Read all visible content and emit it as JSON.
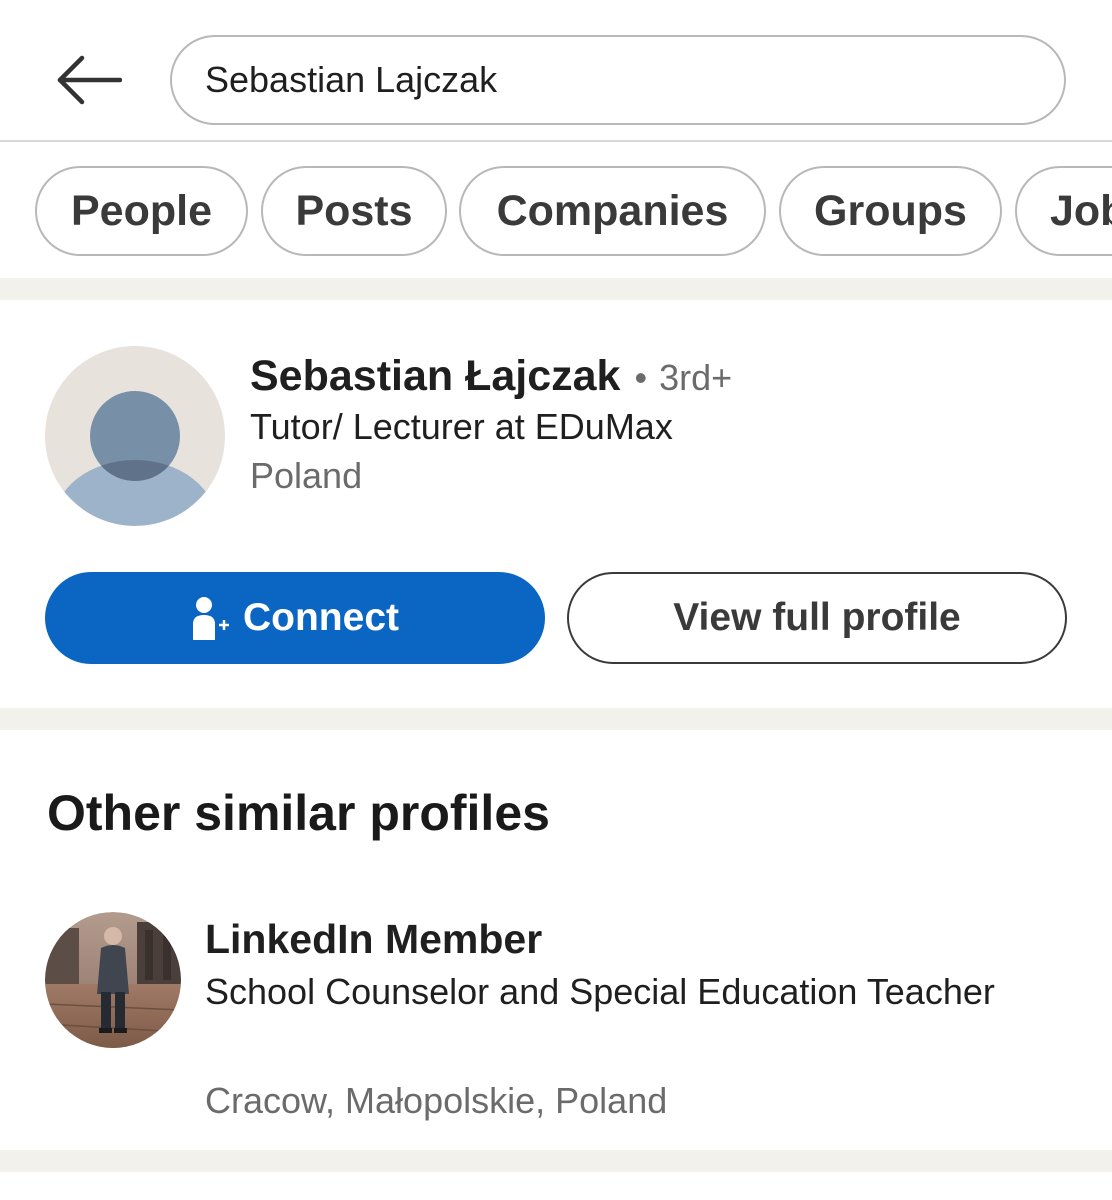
{
  "search": {
    "query": "Sebastian Lajczak"
  },
  "filters": [
    {
      "label": "People"
    },
    {
      "label": "Posts"
    },
    {
      "label": "Companies"
    },
    {
      "label": "Groups"
    },
    {
      "label": "Jobs"
    }
  ],
  "result": {
    "name": "Sebastian Łajczak",
    "separator": "•",
    "degree": "3rd+",
    "headline": "Tutor/ Lecturer at EDuMax",
    "location": "Poland",
    "avatar_icon": "default-person-avatar-icon",
    "connect_label": "Connect",
    "connect_icon": "add-person-icon",
    "view_profile_label": "View full profile"
  },
  "similar": {
    "title": "Other similar profiles",
    "items": [
      {
        "name": "LinkedIn Member",
        "headline": "School Counselor and Special Education Teacher",
        "location": "Cracow, Małopolskie, Poland"
      }
    ]
  },
  "colors": {
    "primary": "#0a66c2",
    "divider": "#f3f1ec",
    "muted_text": "#6b6b6b"
  }
}
